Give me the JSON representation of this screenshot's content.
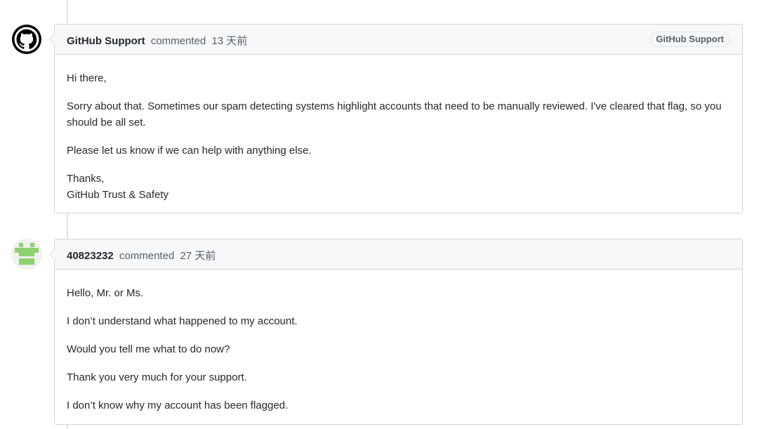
{
  "comments": [
    {
      "author": "GitHub Support",
      "verb": "commented",
      "time": "13 天前",
      "badge": "GitHub Support",
      "avatar_icon": "github-octocat-icon",
      "paragraphs": [
        "Hi there,",
        "Sorry about that. Sometimes our spam detecting systems highlight accounts that need to be manually reviewed. I've cleared that flag, so you should be all set.",
        "Please let us know if we can help with anything else."
      ],
      "signoff_line1": "Thanks,",
      "signoff_line2": "GitHub Trust & Safety"
    },
    {
      "author": "40823232",
      "verb": "commented",
      "time": "27 天前",
      "avatar_icon": "identicon-avatar",
      "paragraphs": [
        "Hello, Mr. or Ms.",
        "I don’t understand what happened to my account.",
        "Would you tell me what to do now?",
        "Thank you very much for your support.",
        "I don’t know why my account has been flagged."
      ]
    }
  ],
  "colors": {
    "identicon": "#8cd26e",
    "header_bg": "#f6f8fa",
    "border": "#d1d5da"
  }
}
